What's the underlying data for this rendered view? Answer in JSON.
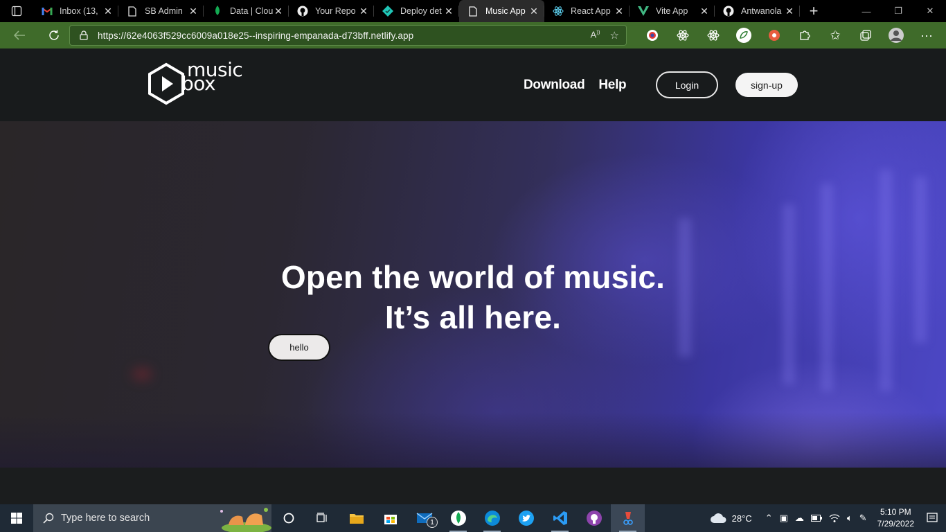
{
  "browser": {
    "tabs": [
      {
        "title": "Inbox (13,",
        "icon": "gmail-icon",
        "active": false
      },
      {
        "title": "SB Admin",
        "icon": "page-icon",
        "active": false
      },
      {
        "title": "Data | Clou",
        "icon": "mongodb-icon",
        "active": false
      },
      {
        "title": "Your Repo",
        "icon": "github-icon",
        "active": false
      },
      {
        "title": "Deploy det",
        "icon": "netlify-icon",
        "active": false
      },
      {
        "title": "Music App",
        "icon": "page-icon",
        "active": true
      },
      {
        "title": "React App",
        "icon": "react-icon",
        "active": false
      },
      {
        "title": "Vite App",
        "icon": "vite-icon",
        "active": false
      },
      {
        "title": "Antwanola",
        "icon": "github-icon",
        "active": false
      }
    ],
    "url": "https://62e4063f529cc6009a018e25--inspiring-empanada-d73bff.netlify.app",
    "toolbar_color": "#3f6b2a"
  },
  "site": {
    "logo": {
      "line1": "music",
      "line2": "box"
    },
    "nav": {
      "download": "Download",
      "help": "Help"
    },
    "login_label": "Login",
    "signup_label": "sign-up",
    "hero": {
      "line1": "Open the world of music.",
      "line2": "It’s all here.",
      "button_label": "hello"
    }
  },
  "taskbar": {
    "search_placeholder": "Type here to search",
    "mail_badge": "1",
    "weather": "28°C",
    "time": "5:10 PM",
    "date": "7/29/2022"
  }
}
